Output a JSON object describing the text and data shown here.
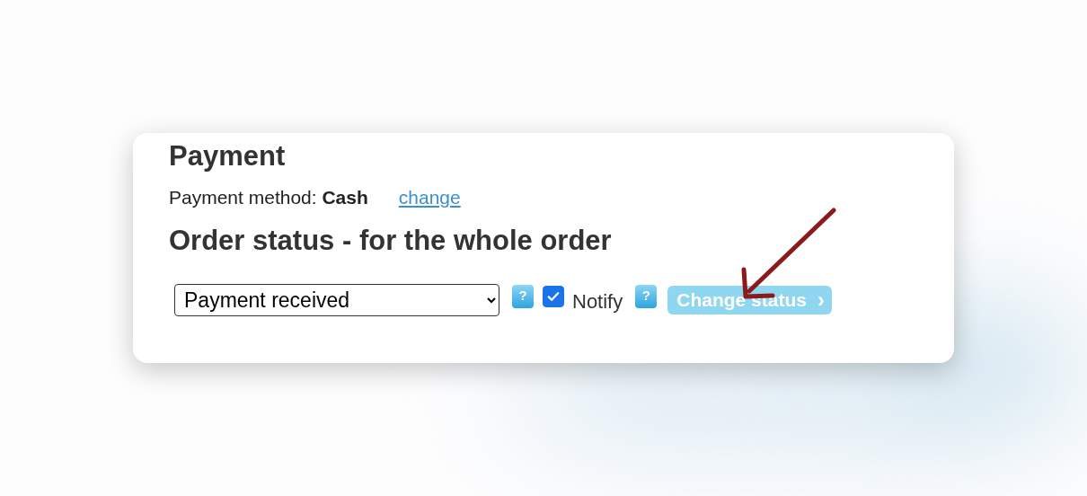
{
  "payment": {
    "title": "Payment",
    "method_line": "Payment method: **Cash**",
    "change_link": "change"
  },
  "order_status": {
    "title": "Order status - for the whole order",
    "status_select": {
      "value": "Payment received"
    },
    "status_help": {
      "label": "?"
    },
    "notify": {
      "label": "Notify",
      "checked": true
    },
    "notify_help": {
      "label": "?"
    },
    "change_button": {
      "label": "Change status",
      "chevron": "›"
    }
  }
}
